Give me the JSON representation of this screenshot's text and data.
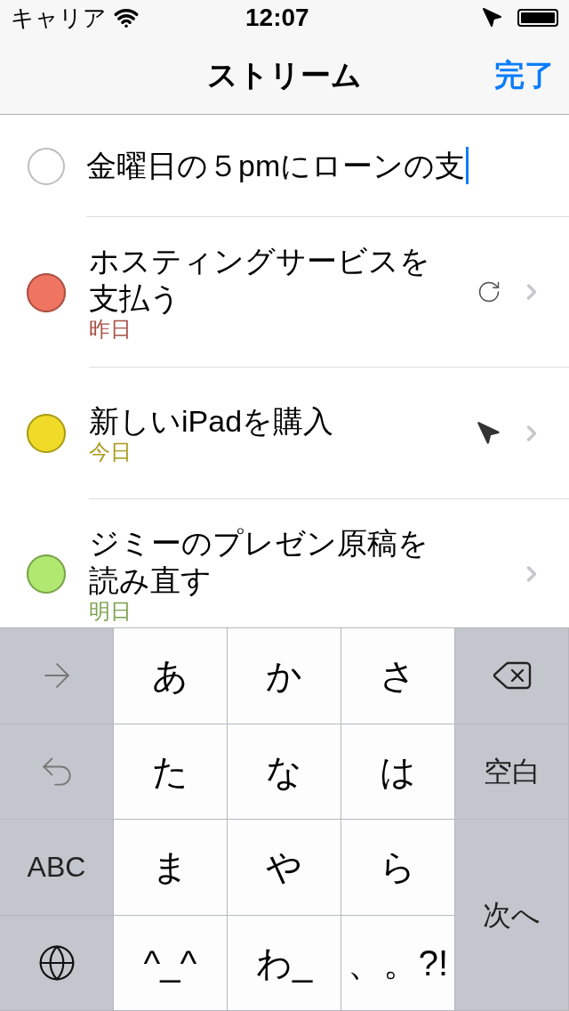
{
  "status_bar": {
    "carrier": "キャリア",
    "time": "12:07"
  },
  "nav": {
    "title": "ストリーム",
    "done": "完了"
  },
  "input": {
    "value": "金曜日の５pmにローンの支"
  },
  "tasks": [
    {
      "title": "ホスティングサービスを支払う",
      "date": "昨日",
      "color": "#f07462",
      "kind": "repeat"
    },
    {
      "title": "新しいiPadを購入",
      "date": "今日",
      "color": "#f0dc28",
      "kind": "location"
    },
    {
      "title": "ジミーのプレゼン原稿を読み直す",
      "date": "明日",
      "color": "#b0e870",
      "kind": "plain"
    }
  ],
  "keyboard": [
    {
      "kind": "arrow"
    },
    {
      "kind": "char",
      "label": "あ"
    },
    {
      "kind": "char",
      "label": "か"
    },
    {
      "kind": "char",
      "label": "さ"
    },
    {
      "kind": "delete"
    },
    {
      "kind": "undo"
    },
    {
      "kind": "char",
      "label": "た"
    },
    {
      "kind": "char",
      "label": "な"
    },
    {
      "kind": "char",
      "label": "は"
    },
    {
      "kind": "side",
      "label": "空白"
    },
    {
      "kind": "side",
      "label": "ABC"
    },
    {
      "kind": "char",
      "label": "ま"
    },
    {
      "kind": "char",
      "label": "や"
    },
    {
      "kind": "char",
      "label": "ら"
    },
    {
      "kind": "return",
      "label": "次へ"
    },
    {
      "kind": "globe"
    },
    {
      "kind": "char",
      "label": "^_^"
    },
    {
      "kind": "char",
      "label": "わ_"
    },
    {
      "kind": "char",
      "label": "、。?!"
    }
  ]
}
